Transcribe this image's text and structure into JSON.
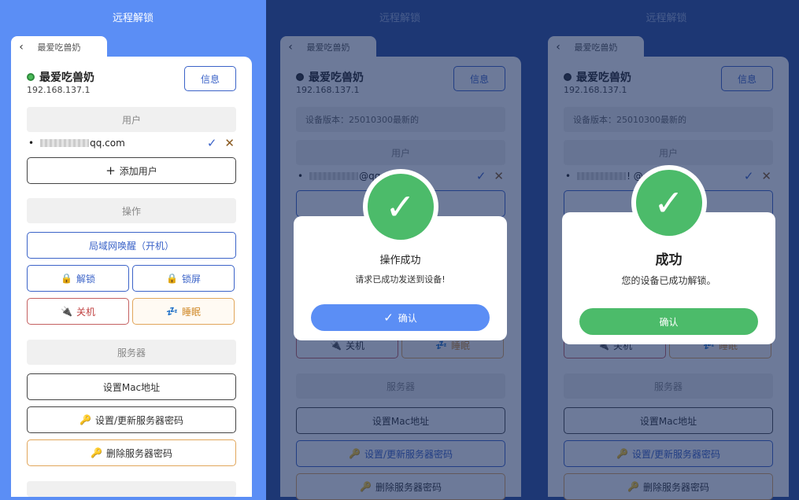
{
  "screen_title": "远程解锁",
  "tab_label": "最爱吃兽奶",
  "device": {
    "name": "最爱吃兽奶",
    "ip": "192.168.137.1"
  },
  "info_button": "信息",
  "version_text": "设备版本：25010300最新的",
  "sections": {
    "users": "用户",
    "operations": "操作",
    "server": "服务器"
  },
  "user": {
    "bullet": "•",
    "email_suffix_1": "qq.com",
    "email_suffix_2": "@qq.c",
    "email_suffix_3": "! @qq"
  },
  "buttons": {
    "add_user": "添加用户",
    "wol": "局域网唤醒（开机）",
    "unlock": "解锁",
    "lock": "锁屏",
    "shutdown": "关机",
    "sleep": "睡眠",
    "set_mac": "设置Mac地址",
    "set_password": "设置/更新服务器密码",
    "delete_password": "删除服务器密码"
  },
  "icons": {
    "back": "‹",
    "check": "✓",
    "close": "✕",
    "plus": "+",
    "lock": "🔒",
    "plug": "🔌",
    "zzz": "💤",
    "key": "🔑"
  },
  "dialog1": {
    "title": "操作成功",
    "message": "请求已成功发送到设备!",
    "button": "确认"
  },
  "dialog2": {
    "title": "成功",
    "message": "您的设备已成功解锁。",
    "button": "确认"
  },
  "colors": {
    "primary": "#5b8ef5",
    "success": "#4cbb6a",
    "overlay": "#2d4f9e"
  }
}
